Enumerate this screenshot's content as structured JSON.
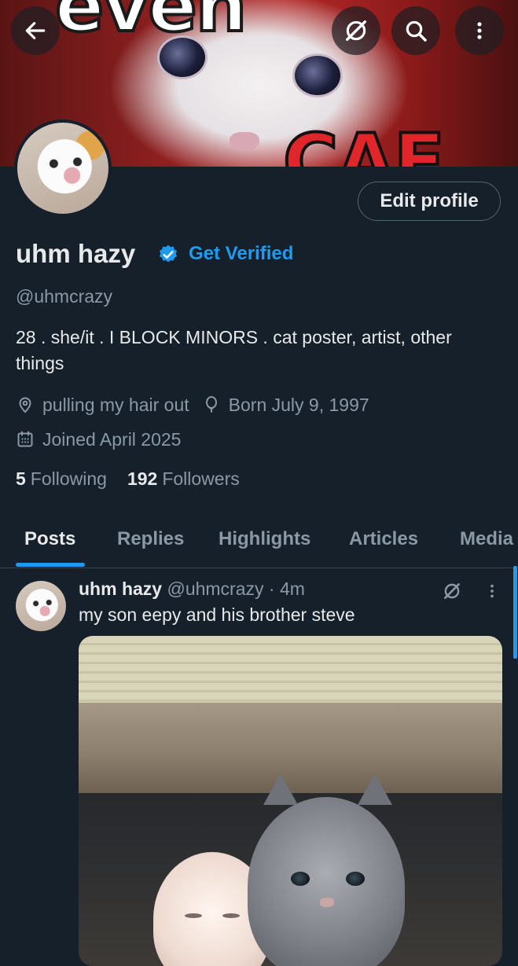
{
  "profile": {
    "name": "uhm hazy",
    "get_verified": "Get Verified",
    "handle": "@uhmcrazy",
    "bio": "28 . she/it . I BLOCK MINORS . cat poster, artist, other things",
    "location": "pulling my hair out",
    "born": "Born July 9, 1997",
    "joined": "Joined April 2025",
    "following_count": "5",
    "following_label": "Following",
    "followers_count": "192",
    "followers_label": "Followers",
    "edit_profile": "Edit profile"
  },
  "tabs": [
    "Posts",
    "Replies",
    "Highlights",
    "Articles",
    "Media"
  ],
  "active_tab": "Posts",
  "post": {
    "author": "uhm hazy",
    "handle": "@uhmcrazy",
    "time": "· 4m",
    "text": "my son eepy and his brother steve"
  },
  "icons": {
    "back": "arrow-left-icon",
    "grok": "grok-icon",
    "search": "search-icon",
    "more": "more-vertical-icon",
    "location": "location-pin-icon",
    "birthday": "balloon-icon",
    "calendar": "calendar-icon",
    "verified": "verified-badge-icon"
  },
  "colors": {
    "background": "#15202b",
    "accent": "#1d9bf0",
    "secondary_text": "#8b98a5",
    "primary_text": "#e7e9ea"
  }
}
